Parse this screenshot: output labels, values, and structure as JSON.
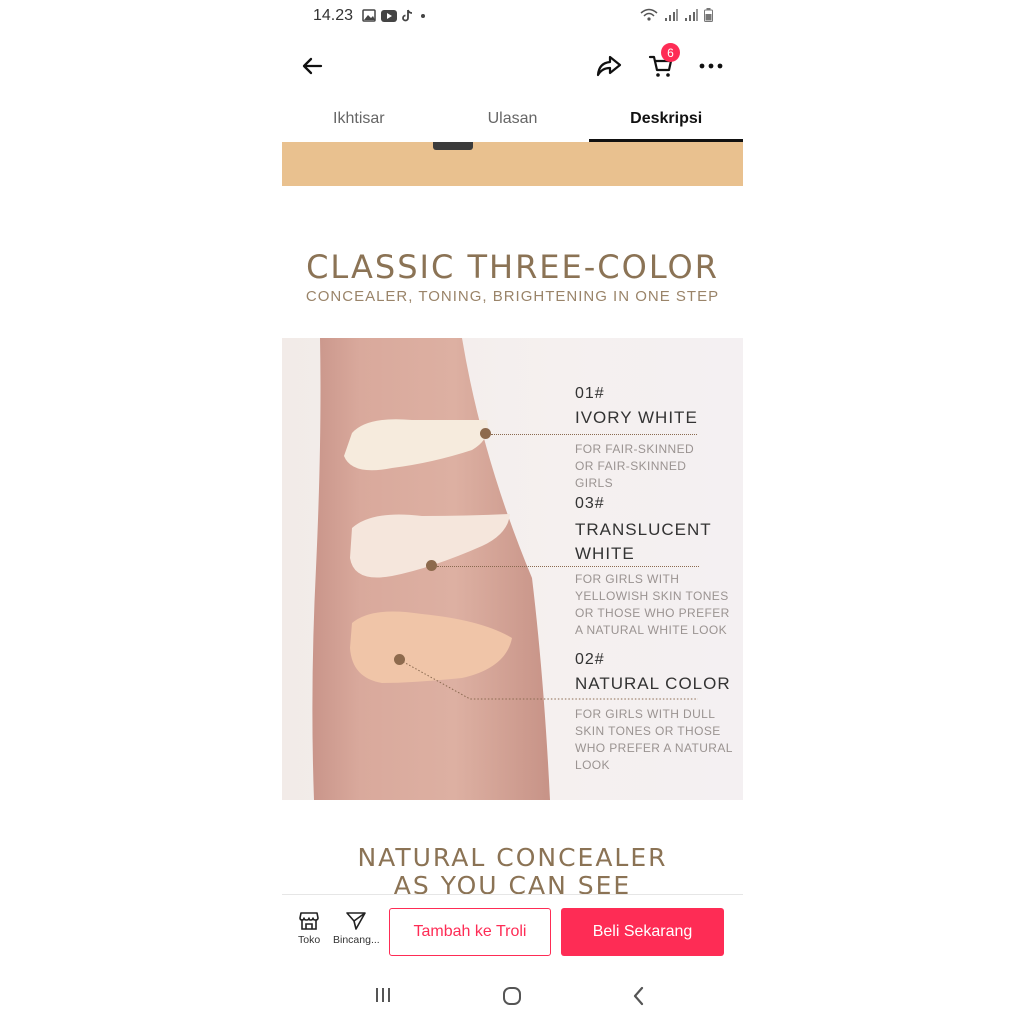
{
  "status_bar": {
    "time": "14.23"
  },
  "app_bar": {
    "cart_count": "6"
  },
  "tabs": [
    {
      "label": "Ikhtisar",
      "active": false
    },
    {
      "label": "Ulasan",
      "active": false
    },
    {
      "label": "Deskripsi",
      "active": true
    }
  ],
  "content": {
    "heading": "CLASSIC THREE-COLOR",
    "subheading": "CONCEALER, TONING, BRIGHTENING IN ONE STEP",
    "shades": [
      {
        "code": "01#",
        "name": "IVORY WHITE",
        "desc": "FOR FAIR-SKINNED OR FAIR-SKINNED GIRLS"
      },
      {
        "code": "03#",
        "name": "TRANSLUCENT WHITE",
        "desc": "FOR GIRLS WITH YELLOWISH SKIN TONES OR THOSE WHO PREFER A NATURAL WHITE LOOK"
      },
      {
        "code": "02#",
        "name": "NATURAL COLOR",
        "desc": "FOR GIRLS WITH DULL SKIN TONES OR THOSE WHO PREFER A NATURAL LOOK"
      }
    ],
    "heading2_line1": "NATURAL CONCEALER",
    "heading2_line2": "AS YOU CAN SEE"
  },
  "bottom_bar": {
    "shop_label": "Toko",
    "chat_label": "Bincang...",
    "add_to_cart": "Tambah ke Troli",
    "buy_now": "Beli Sekarang"
  },
  "colors": {
    "accent": "#fe2c55",
    "heading": "#8b7355"
  }
}
